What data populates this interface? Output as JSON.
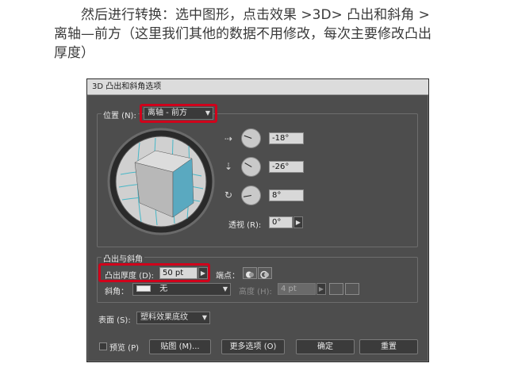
{
  "intro": {
    "line1": "然后进行转换：选中图形，点击效果 >3D> 凸出和斜角 >",
    "line2": "离轴—前方（这里我们其他的数据不用修改，每次主要修改凸出",
    "line3": "厚度）"
  },
  "dialog": {
    "title": "3D 凸出和斜角选项",
    "position": {
      "label": "位置 (N):",
      "value": "离轴 - 前方"
    },
    "rotation": {
      "x": "-18°",
      "y": "-26°",
      "z": "8°"
    },
    "perspective": {
      "label": "透视 (R):",
      "value": "0°"
    },
    "extrude": {
      "section_label": "凸出与斜角",
      "depth_label": "凸出厚度 (D):",
      "depth_value": "50 pt",
      "cap_label": "端点：",
      "bevel_label": "斜角：",
      "bevel_value": "无",
      "height_label": "高度 (H):",
      "height_value": "4 pt"
    },
    "surface": {
      "label": "表面 (S):",
      "value": "塑料效果底纹"
    },
    "footer": {
      "preview_label": "预览 (P)",
      "map_button": "贴图 (M)...",
      "more_options_button": "更多选项 (O)",
      "ok_button": "确定",
      "reset_button": "重置"
    }
  },
  "colors": {
    "highlight": "#d0021b",
    "cube_front": "#5aa9c0",
    "grid": "#2fb3c6"
  }
}
